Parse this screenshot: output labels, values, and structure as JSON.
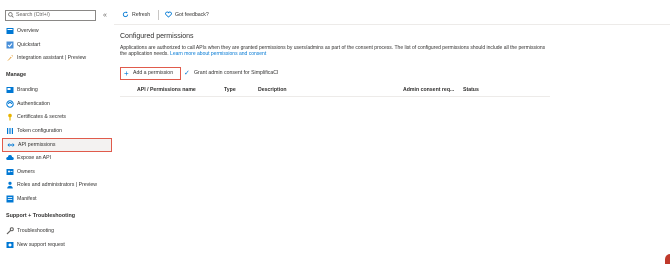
{
  "sidebar": {
    "search_placeholder": "Search (Ctrl+/)",
    "collapse_glyph": "«",
    "items_top": [
      {
        "label": "Overview",
        "icon": "overview-icon"
      },
      {
        "label": "Quickstart",
        "icon": "quickstart-icon"
      },
      {
        "label": "Integration assistant | Preview",
        "icon": "rocket-icon"
      }
    ],
    "section_manage": "Manage",
    "items_manage": [
      {
        "label": "Branding",
        "icon": "branding-icon"
      },
      {
        "label": "Authentication",
        "icon": "authentication-icon"
      },
      {
        "label": "Certificates & secrets",
        "icon": "key-icon"
      },
      {
        "label": "Token configuration",
        "icon": "token-icon"
      },
      {
        "label": "API permissions",
        "icon": "api-permissions-icon",
        "selected": true
      },
      {
        "label": "Expose an API",
        "icon": "cloud-icon"
      },
      {
        "label": "Owners",
        "icon": "owners-icon"
      },
      {
        "label": "Roles and administrators | Preview",
        "icon": "roles-icon"
      },
      {
        "label": "Manifest",
        "icon": "manifest-icon"
      }
    ],
    "section_support": "Support + Troubleshooting",
    "items_support": [
      {
        "label": "Troubleshooting",
        "icon": "wrench-icon"
      },
      {
        "label": "New support request",
        "icon": "support-request-icon"
      }
    ]
  },
  "toolbar": {
    "refresh_label": "Refresh",
    "feedback_label": "Got feedback?"
  },
  "main": {
    "title": "Configured permissions",
    "description": "Applications are authorized to call APIs when they are granted permissions by users/admins as part of the consent process. The list of configured permissions should include all the permissions the application needs.",
    "description_link": "Learn more about permissions and consent",
    "add_permission_label": "Add a permission",
    "grant_consent_label": "Grant admin consent for SimplificaCI",
    "columns": [
      "API / Permissions name",
      "Type",
      "Description",
      "Admin consent req...",
      "Status"
    ]
  },
  "colors": {
    "accent": "#0078d4",
    "highlight_border": "#e05b4c"
  }
}
